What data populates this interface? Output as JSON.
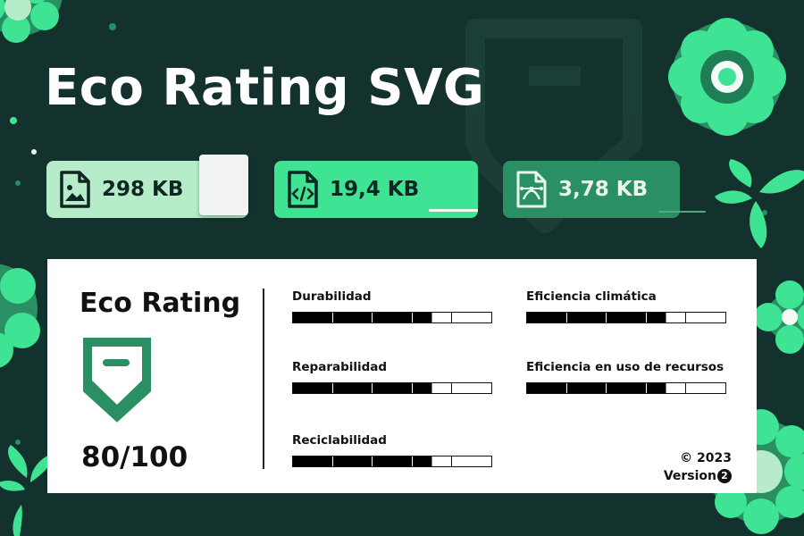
{
  "title": "Eco Rating SVG",
  "file_sizes": [
    {
      "icon": "image-file-icon",
      "value": "298 KB"
    },
    {
      "icon": "code-file-icon",
      "value": "19,4 KB"
    },
    {
      "icon": "vector-file-icon",
      "value": "3,78 KB"
    }
  ],
  "card": {
    "title": "Eco Rating",
    "logo_icon": "eco-rating-shield-icon",
    "score": "80/100",
    "metrics": [
      {
        "label": "Durabilidad",
        "segments": 5,
        "filled": 3.5
      },
      {
        "label": "Eficiencia climática",
        "segments": 5,
        "filled": 3.5
      },
      {
        "label": "Reparabilidad",
        "segments": 5,
        "filled": 3.5
      },
      {
        "label": "Eficiencia en uso de recursos",
        "segments": 5,
        "filled": 3.5
      },
      {
        "label": "Reciclabilidad",
        "segments": 5,
        "filled": 3.5
      }
    ],
    "copyright": "© 2023",
    "version_text": "Version",
    "version_number": "2"
  },
  "colors": {
    "background": "#13322d",
    "chip_light": "#b6ecc9",
    "chip_bright": "#3ee394",
    "chip_dark": "#2a8f63",
    "flower": "#3ee394"
  }
}
